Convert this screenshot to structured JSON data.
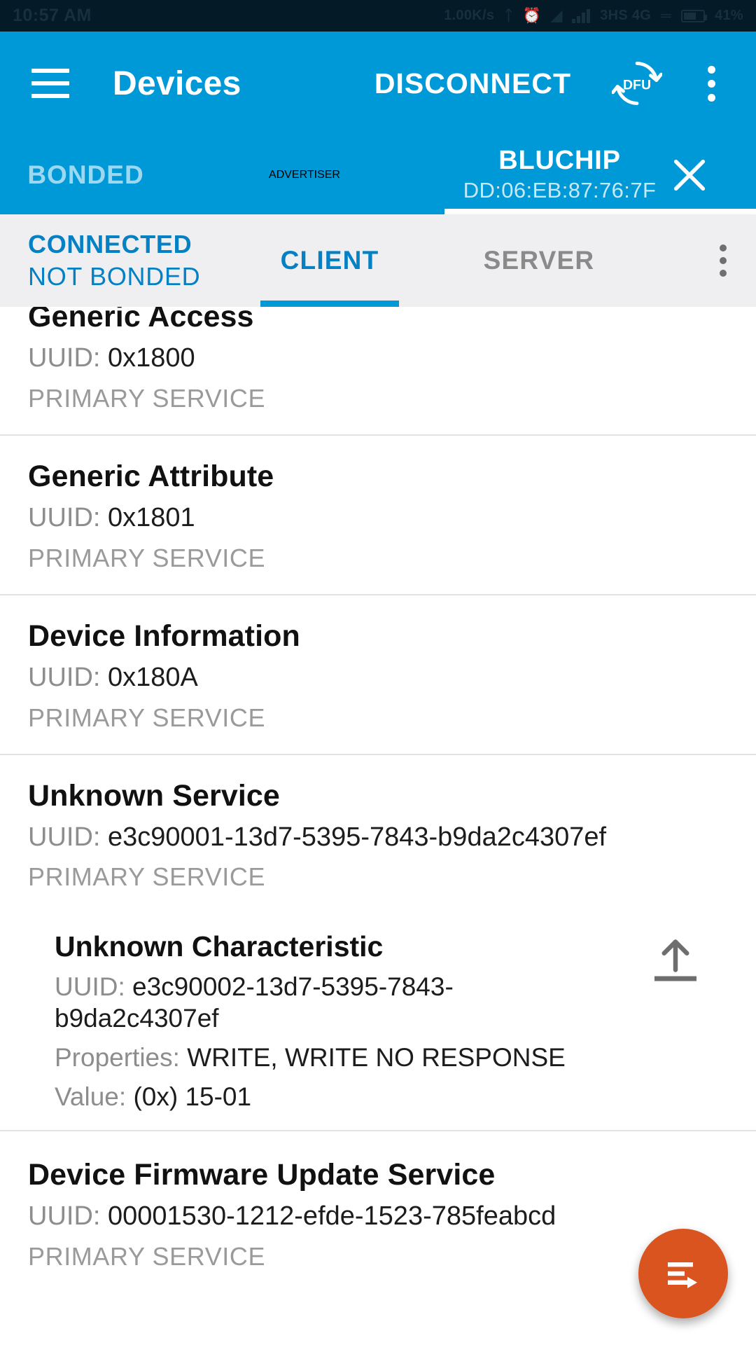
{
  "status_bar": {
    "time": "10:57 AM",
    "network_speed": "1.00K/s",
    "signal_label": "3HS 4G",
    "battery": "41%",
    "icons": [
      "bluetooth-icon",
      "alarm-icon",
      "wifi-icon",
      "signal-icon",
      "vibrate-icon",
      "battery-icon"
    ]
  },
  "appbar": {
    "menu_icon": "hamburger-menu-icon",
    "title": "Devices",
    "disconnect_label": "DISCONNECT",
    "dfu_label": "DFU",
    "dfu_icon": "dfu-refresh-icon",
    "overflow_icon": "more-vertical-icon"
  },
  "tabs": {
    "items": [
      {
        "label": "BONDED",
        "active": false
      },
      {
        "label": "ADVERTISER",
        "active": false
      }
    ],
    "device_tab": {
      "name": "BLUCHIP",
      "address": "DD:06:EB:87:76:7F",
      "close_icon": "close-icon",
      "active": true
    },
    "indicator_color": "#ffffff"
  },
  "connection": {
    "state": "CONNECTED",
    "bond_state": "NOT BONDED",
    "accent_color": "#0481c4",
    "subtabs": [
      {
        "label": "CLIENT",
        "active": true
      },
      {
        "label": "SERVER",
        "active": false
      }
    ],
    "overflow_icon": "more-vertical-icon"
  },
  "services": [
    {
      "name": "Generic Access",
      "uuid_label": "UUID:",
      "uuid": "0x1800",
      "type": "PRIMARY SERVICE",
      "clipped_top": true
    },
    {
      "name": "Generic Attribute",
      "uuid_label": "UUID:",
      "uuid": "0x1801",
      "type": "PRIMARY SERVICE"
    },
    {
      "name": "Device Information",
      "uuid_label": "UUID:",
      "uuid": "0x180A",
      "type": "PRIMARY SERVICE"
    },
    {
      "name": "Unknown Service",
      "uuid_label": "UUID:",
      "uuid": "e3c90001-13d7-5395-7843-b9da2c4307ef",
      "type": "PRIMARY SERVICE",
      "characteristic": {
        "name": "Unknown Characteristic",
        "uuid_label": "UUID:",
        "uuid": "e3c90002-13d7-5395-7843-b9da2c4307ef",
        "properties_label": "Properties:",
        "properties": "WRITE, WRITE NO RESPONSE",
        "value_label": "Value:",
        "value": "(0x) 15-01",
        "action_icon": "write-upload-icon"
      }
    },
    {
      "name": "Device Firmware Update Service",
      "uuid_label": "UUID:",
      "uuid": "00001530-1212-efde-1523-785feabcd",
      "type": "PRIMARY SERVICE",
      "clipped_bottom": true
    }
  ],
  "fab": {
    "icon": "show-log-icon",
    "color": "#d9541f"
  }
}
